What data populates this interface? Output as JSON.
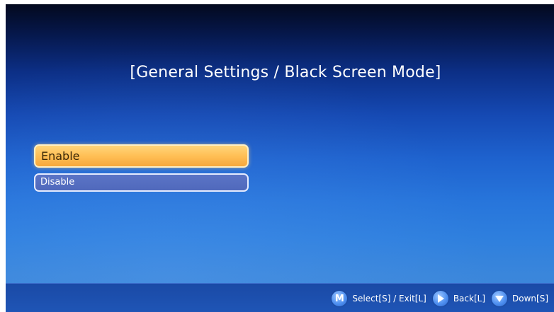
{
  "menu": {
    "title": "[General Settings / Black Screen Mode]",
    "options": [
      {
        "label": "Enable",
        "selected": true
      },
      {
        "label": "Disable",
        "selected": false
      }
    ]
  },
  "footer": {
    "hints": [
      {
        "icon": "m-button-icon",
        "icon_text": "M",
        "label": "Select[S] / Exit[L]"
      },
      {
        "icon": "play-right-icon",
        "label": "Back[L]"
      },
      {
        "icon": "triangle-down-icon",
        "label": "Down[S]"
      }
    ]
  },
  "colors": {
    "background_top": "#03091e",
    "background_bottom": "#3f88d8",
    "selected_option": "#ffbf55",
    "normal_option": "#5069bc",
    "footer_bar": "#1f55b6"
  }
}
